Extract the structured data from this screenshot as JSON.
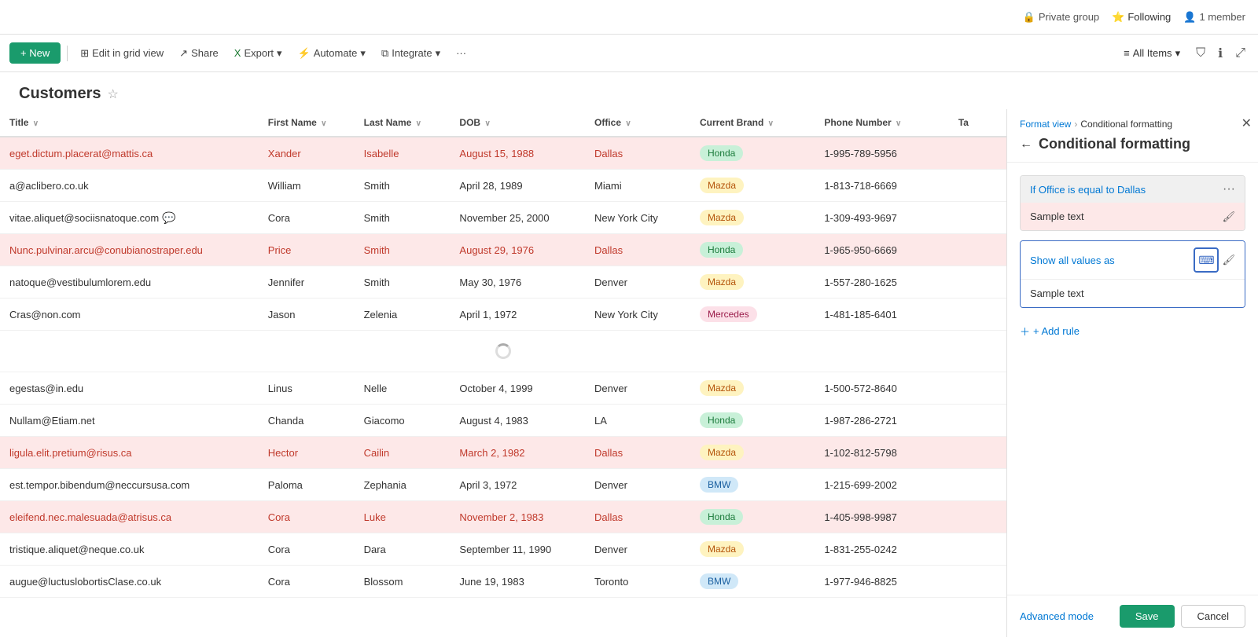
{
  "topbar": {
    "private_group": "Private group",
    "following": "Following",
    "member_count": "1 member"
  },
  "toolbar": {
    "new_label": "+ New",
    "edit_grid_label": "Edit in grid view",
    "share_label": "Share",
    "export_label": "Export",
    "automate_label": "Automate",
    "integrate_label": "Integrate",
    "more_label": "···",
    "all_items_label": "All Items"
  },
  "page": {
    "title": "Customers"
  },
  "table": {
    "columns": [
      "Title",
      "First Name",
      "Last Name",
      "DOB",
      "Office",
      "Current Brand",
      "Phone Number",
      "Ta"
    ],
    "rows": [
      {
        "title": "eget.dictum.placerat@mattis.ca",
        "firstName": "Xander",
        "lastName": "Isabelle",
        "dob": "August 15, 1988",
        "office": "Dallas",
        "brand": "Honda",
        "phone": "1-995-789-5956",
        "ta": "",
        "highlight": true,
        "hasChat": false
      },
      {
        "title": "a@aclibero.co.uk",
        "firstName": "William",
        "lastName": "Smith",
        "dob": "April 28, 1989",
        "office": "Miami",
        "brand": "Mazda",
        "phone": "1-813-718-6669",
        "ta": "",
        "highlight": false,
        "hasChat": false
      },
      {
        "title": "vitae.aliquet@sociisnatoque.com",
        "firstName": "Cora",
        "lastName": "Smith",
        "dob": "November 25, 2000",
        "office": "New York City",
        "brand": "Mazda",
        "phone": "1-309-493-9697",
        "ta": "",
        "highlight": false,
        "hasChat": true
      },
      {
        "title": "Nunc.pulvinar.arcu@conubianostraper.edu",
        "firstName": "Price",
        "lastName": "Smith",
        "dob": "August 29, 1976",
        "office": "Dallas",
        "brand": "Honda",
        "phone": "1-965-950-6669",
        "ta": "",
        "highlight": true,
        "hasChat": false
      },
      {
        "title": "natoque@vestibulumlorem.edu",
        "firstName": "Jennifer",
        "lastName": "Smith",
        "dob": "May 30, 1976",
        "office": "Denver",
        "brand": "Mazda",
        "phone": "1-557-280-1625",
        "ta": "",
        "highlight": false,
        "hasChat": false
      },
      {
        "title": "Cras@non.com",
        "firstName": "Jason",
        "lastName": "Zelenia",
        "dob": "April 1, 1972",
        "office": "New York City",
        "brand": "Mercedes",
        "phone": "1-481-185-6401",
        "ta": "",
        "highlight": false,
        "hasChat": false
      },
      {
        "title": "",
        "firstName": "",
        "lastName": "",
        "dob": "",
        "office": "",
        "brand": "",
        "phone": "",
        "ta": "",
        "highlight": false,
        "hasChat": false,
        "loading": true
      },
      {
        "title": "egestas@in.edu",
        "firstName": "Linus",
        "lastName": "Nelle",
        "dob": "October 4, 1999",
        "office": "Denver",
        "brand": "Mazda",
        "phone": "1-500-572-8640",
        "ta": "",
        "highlight": false,
        "hasChat": false
      },
      {
        "title": "Nullam@Etiam.net",
        "firstName": "Chanda",
        "lastName": "Giacomo",
        "dob": "August 4, 1983",
        "office": "LA",
        "brand": "Honda",
        "phone": "1-987-286-2721",
        "ta": "",
        "highlight": false,
        "hasChat": false
      },
      {
        "title": "ligula.elit.pretium@risus.ca",
        "firstName": "Hector",
        "lastName": "Cailin",
        "dob": "March 2, 1982",
        "office": "Dallas",
        "brand": "Mazda",
        "phone": "1-102-812-5798",
        "ta": "",
        "highlight": true,
        "hasChat": false
      },
      {
        "title": "est.tempor.bibendum@neccursusa.com",
        "firstName": "Paloma",
        "lastName": "Zephania",
        "dob": "April 3, 1972",
        "office": "Denver",
        "brand": "BMW",
        "phone": "1-215-699-2002",
        "ta": "",
        "highlight": false,
        "hasChat": false
      },
      {
        "title": "eleifend.nec.malesuada@atrisus.ca",
        "firstName": "Cora",
        "lastName": "Luke",
        "dob": "November 2, 1983",
        "office": "Dallas",
        "brand": "Honda",
        "phone": "1-405-998-9987",
        "ta": "",
        "highlight": true,
        "hasChat": false
      },
      {
        "title": "tristique.aliquet@neque.co.uk",
        "firstName": "Cora",
        "lastName": "Dara",
        "dob": "September 11, 1990",
        "office": "Denver",
        "brand": "Mazda",
        "phone": "1-831-255-0242",
        "ta": "",
        "highlight": false,
        "hasChat": false
      },
      {
        "title": "augue@luctuslobortisClase.co.uk",
        "firstName": "Cora",
        "lastName": "Blossom",
        "dob": "June 19, 1983",
        "office": "Toronto",
        "brand": "BMW",
        "phone": "1-977-946-8825",
        "ta": "",
        "highlight": false,
        "hasChat": false
      }
    ]
  },
  "side_panel": {
    "breadcrumb_format": "Format view",
    "breadcrumb_current": "Conditional formatting",
    "title": "Conditional formatting",
    "rule_condition": "If Office is equal to Dallas",
    "rule_sample_text": "Sample text",
    "show_values_label": "Show all values as",
    "show_values_sample": "Sample text",
    "add_rule_label": "+ Add rule",
    "advanced_mode_label": "Advanced mode",
    "save_label": "Save",
    "cancel_label": "Cancel"
  }
}
